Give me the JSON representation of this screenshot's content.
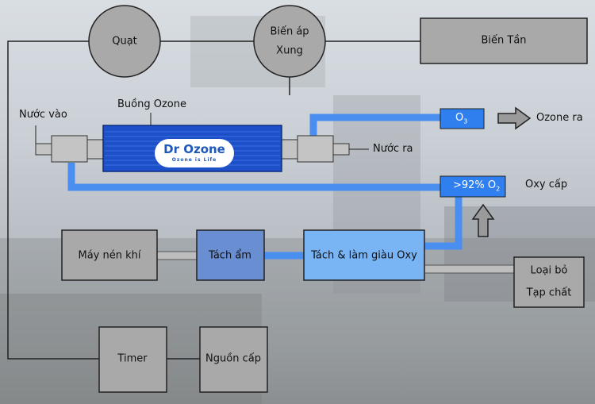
{
  "labels": {
    "quat": "Quạt",
    "bien_ap_line1": "Biến áp",
    "bien_ap_line2": "Xung",
    "bien_tan": "Biến Tần",
    "buong_ozone": "Buồng Ozone",
    "nuoc_vao": "Nước vào",
    "nuoc_ra": "Nước ra",
    "o3_box": "O",
    "o3_sub": "3",
    "ozone_ra": "Ozone ra",
    "oxy_box": ">92% O",
    "oxy_sub": "2",
    "oxy_cap": "Oxy cấp",
    "may_nen_khi": "Máy nén khí",
    "tach_am": "Tách ẩm",
    "tach_lam_giau": "Tách & làm giàu Oxy",
    "loai_bo_line1": "Loại bỏ",
    "loai_bo_line2": "Tạp chất",
    "timer": "Timer",
    "nguon_cap": "Nguồn cấp"
  },
  "logo": {
    "brand": "Dr Ozone",
    "tagline": "Ozone is Life"
  },
  "colors": {
    "gray_box": "#a9a9a9",
    "pipe_blue": "#4a8ef0",
    "chamber_blue": "#1c4fc8",
    "tach_am_blue": "#6a8ed2",
    "tach_oxy_blue": "#79b4f5",
    "small_box_blue": "#2f7fef"
  }
}
